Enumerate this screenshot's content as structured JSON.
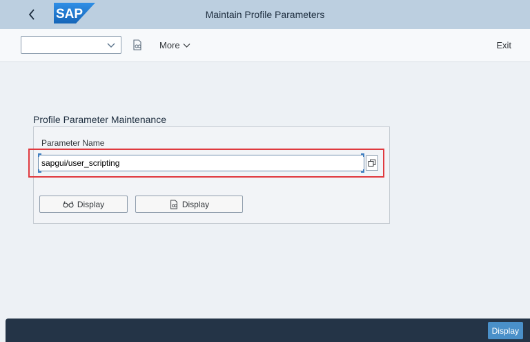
{
  "shellbar": {
    "title": "Maintain Profile Parameters",
    "logo_text": "SAP",
    "back_icon": "chevron-left-icon",
    "colors": {
      "background": "#bccfe0",
      "logo": "#1a73c9"
    }
  },
  "toolbar": {
    "command_field_value": "",
    "command_field_icon": "chevron-down-icon",
    "tool_icon": "display-object-icon",
    "more_label": "More",
    "more_icon": "chevron-down-icon",
    "exit_label": "Exit"
  },
  "form": {
    "group_title": "Profile Parameter Maintenance",
    "param_label": "Parameter Name",
    "param_value": "sapgui/user_scripting",
    "value_help_icon": "value-help-icon",
    "highlight_color": "#e0393e",
    "buttons": [
      {
        "label": "Display",
        "icon": "glasses-icon"
      },
      {
        "label": "Display",
        "icon": "display-object-icon"
      }
    ]
  },
  "footer": {
    "primary_button_label": "Display",
    "colors": {
      "background": "#243447",
      "button": "#4a90c9"
    }
  }
}
